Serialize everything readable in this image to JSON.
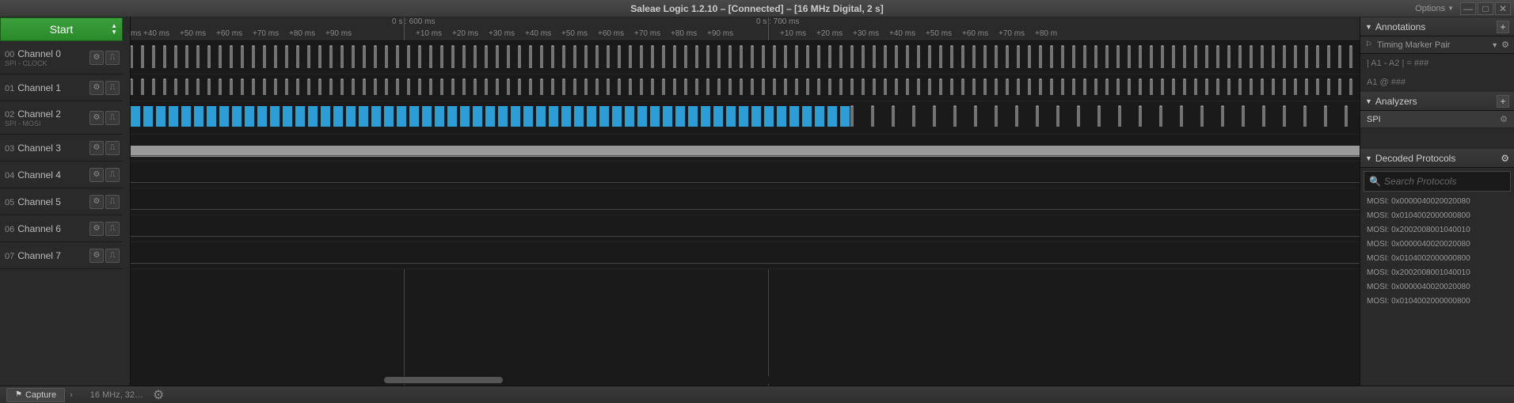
{
  "titlebar": {
    "title": "Saleae Logic 1.2.10 – [Connected] – [16 MHz Digital, 2 s]",
    "options_label": "Options"
  },
  "start_label": "Start",
  "channels": [
    {
      "num": "00",
      "name": "Channel 0",
      "sub": "SPI - CLOCK",
      "color": "#d0d0d0"
    },
    {
      "num": "01",
      "name": "Channel 1",
      "sub": "",
      "color": "#a07040"
    },
    {
      "num": "02",
      "name": "Channel 2",
      "sub": "SPI - MOSI",
      "color": "#d03030"
    },
    {
      "num": "03",
      "name": "Channel 3",
      "sub": "",
      "color": "#d08030"
    },
    {
      "num": "04",
      "name": "Channel 4",
      "sub": "",
      "color": "#c0a030"
    },
    {
      "num": "05",
      "name": "Channel 5",
      "sub": "",
      "color": "#60a030"
    },
    {
      "num": "06",
      "name": "Channel 6",
      "sub": "",
      "color": "#3080c0"
    },
    {
      "num": "07",
      "name": "Channel 7",
      "sub": "",
      "color": "#8040c0"
    }
  ],
  "timeline": {
    "markers": [
      "0 s : 600 ms",
      "0 s : 700 ms"
    ],
    "ticks_left": [
      "ms",
      "+40 ms",
      "+50 ms",
      "+60 ms",
      "+70 ms",
      "+80 ms",
      "+90 ms"
    ],
    "ticks_mid": [
      "+10 ms",
      "+20 ms",
      "+30 ms",
      "+40 ms",
      "+50 ms",
      "+60 ms",
      "+70 ms",
      "+80 ms",
      "+90 ms"
    ],
    "ticks_right": [
      "+10 ms",
      "+20 ms",
      "+30 ms",
      "+40 ms",
      "+50 ms",
      "+60 ms",
      "+70 ms",
      "+80 m"
    ]
  },
  "annotations": {
    "header": "Annotations",
    "marker_pair": "Timing Marker Pair",
    "line1": "| A1 - A2 | =  ###",
    "line2": "A1  @  ###"
  },
  "analyzers": {
    "header": "Analyzers",
    "item": "SPI"
  },
  "decoded": {
    "header": "Decoded Protocols",
    "placeholder": "Search Protocols",
    "lines": [
      "MOSI: 0x0000040020020080",
      "MOSI: 0x0104002000000800",
      "MOSI: 0x2002008001040010",
      "MOSI: 0x0000040020020080",
      "MOSI: 0x0104002000000800",
      "MOSI: 0x2002008001040010",
      "MOSI: 0x0000040020020080",
      "MOSI: 0x0104002000000800"
    ]
  },
  "bottom": {
    "capture": "Capture",
    "info": "16 MHz, 32…"
  }
}
